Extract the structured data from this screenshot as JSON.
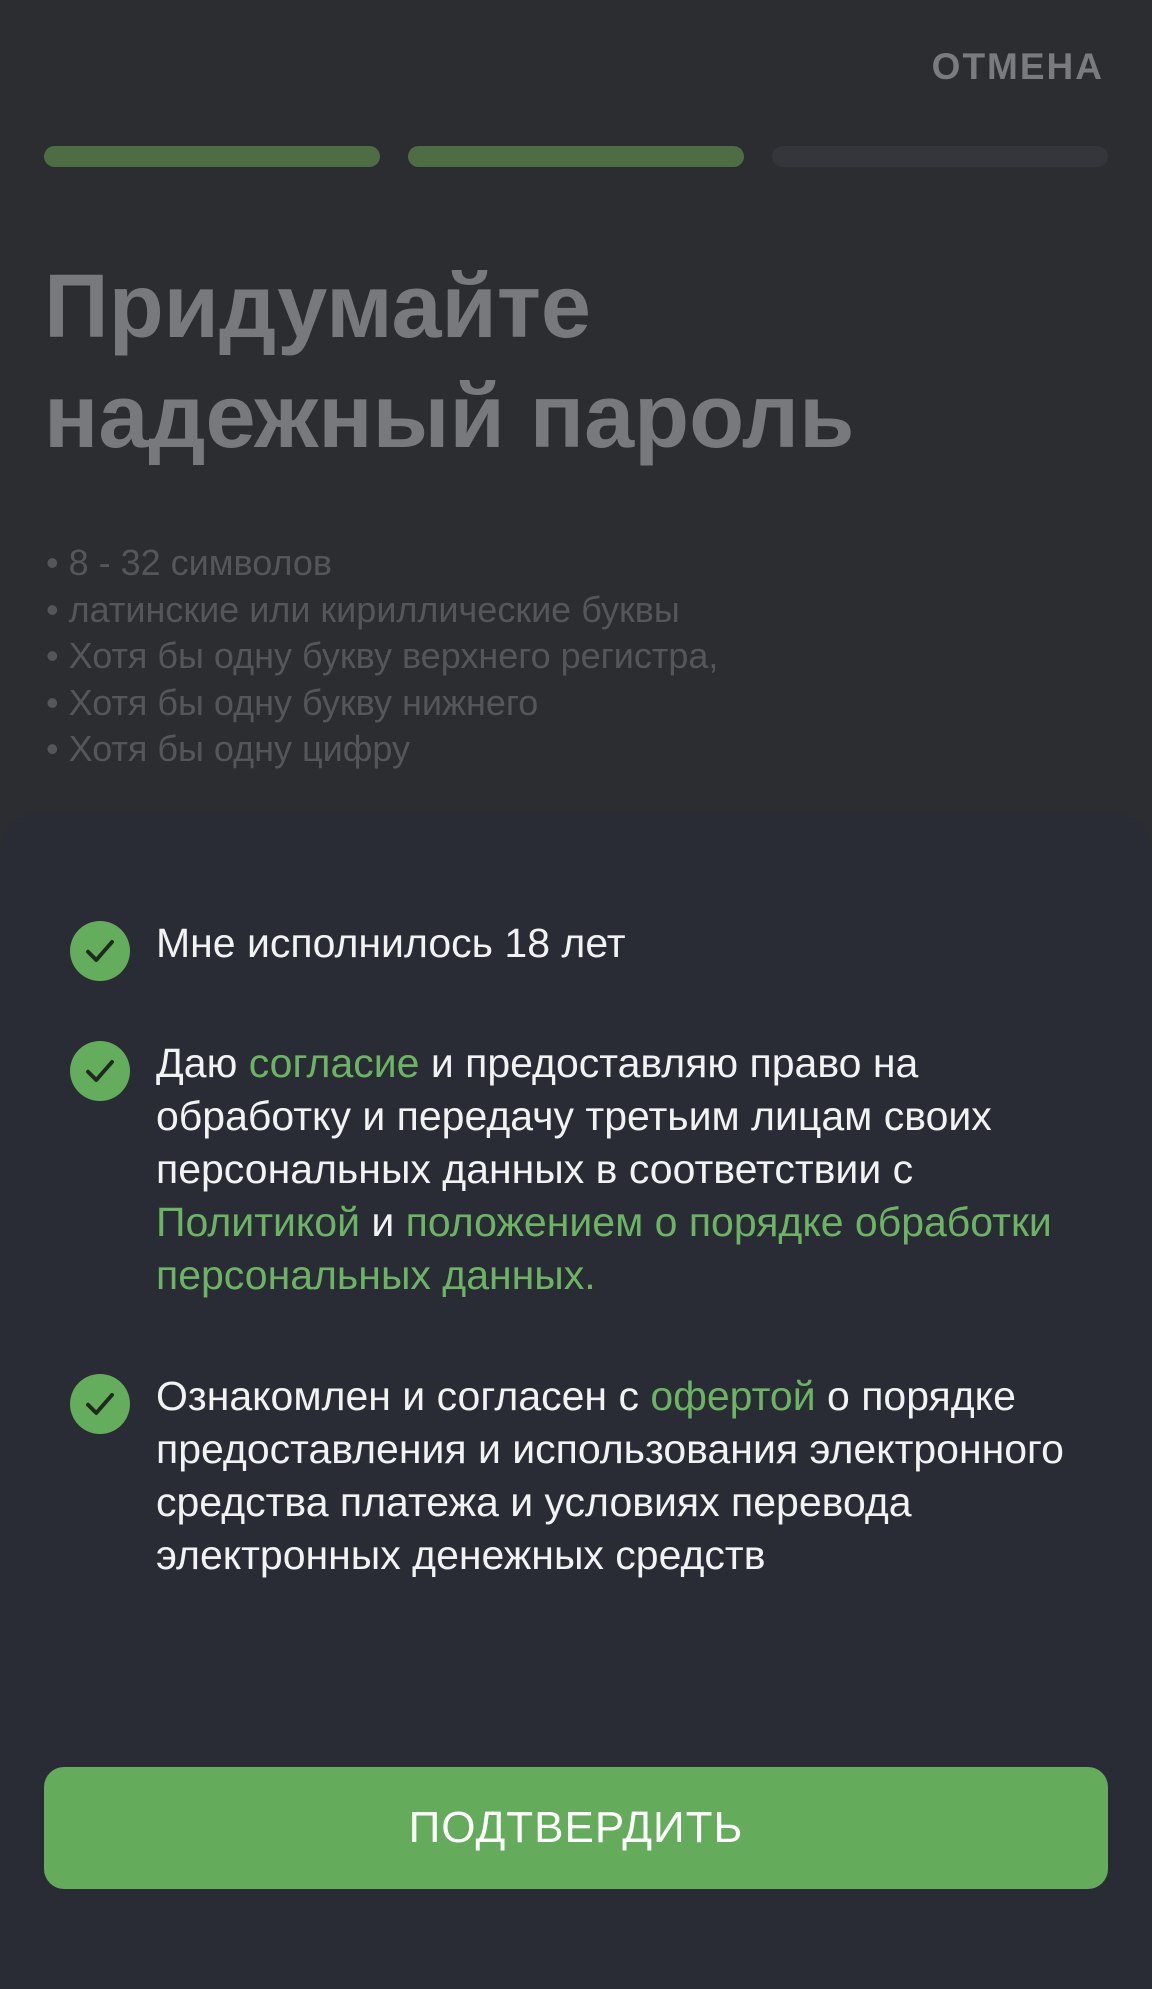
{
  "header": {
    "cancel_label": "ОТМЕНА"
  },
  "progress": {
    "total_steps": 3,
    "completed_steps": 2
  },
  "page": {
    "title_line1": "Придумайте",
    "title_line2": "надежный пароль",
    "rules": [
      "8 - 32 символов",
      "латинские или кириллические буквы",
      "Хотя бы одну букву верхнего регистра,",
      "Хотя бы одну букву нижнего",
      "Хотя бы одну цифру"
    ]
  },
  "sheet": {
    "consents": [
      {
        "checked": true,
        "text": "Мне исполнилось 18 лет"
      },
      {
        "checked": true,
        "t1": "Даю ",
        "link1": "согласие",
        "t2": " и предоставляю право на обработку и передачу третьим лицам своих персональных данных в соответствии с ",
        "link2": "Политикой",
        "t3": " и ",
        "link3": "положением о порядке обработки персональных данных."
      },
      {
        "checked": true,
        "t1": "Ознакомлен и согласен с ",
        "link1": "офертой",
        "t2": " о порядке предоставления и использования электронного средства платежа и условиях перевода электронных денежных средств"
      }
    ],
    "confirm_label": "ПОДТВЕРДИТЬ"
  },
  "colors": {
    "accent": "#64ac5b",
    "link": "#6cb464",
    "sheet_bg": "#292c34",
    "background": "#2c2d31"
  },
  "icons": {
    "check": "checkmark-circle-icon"
  }
}
